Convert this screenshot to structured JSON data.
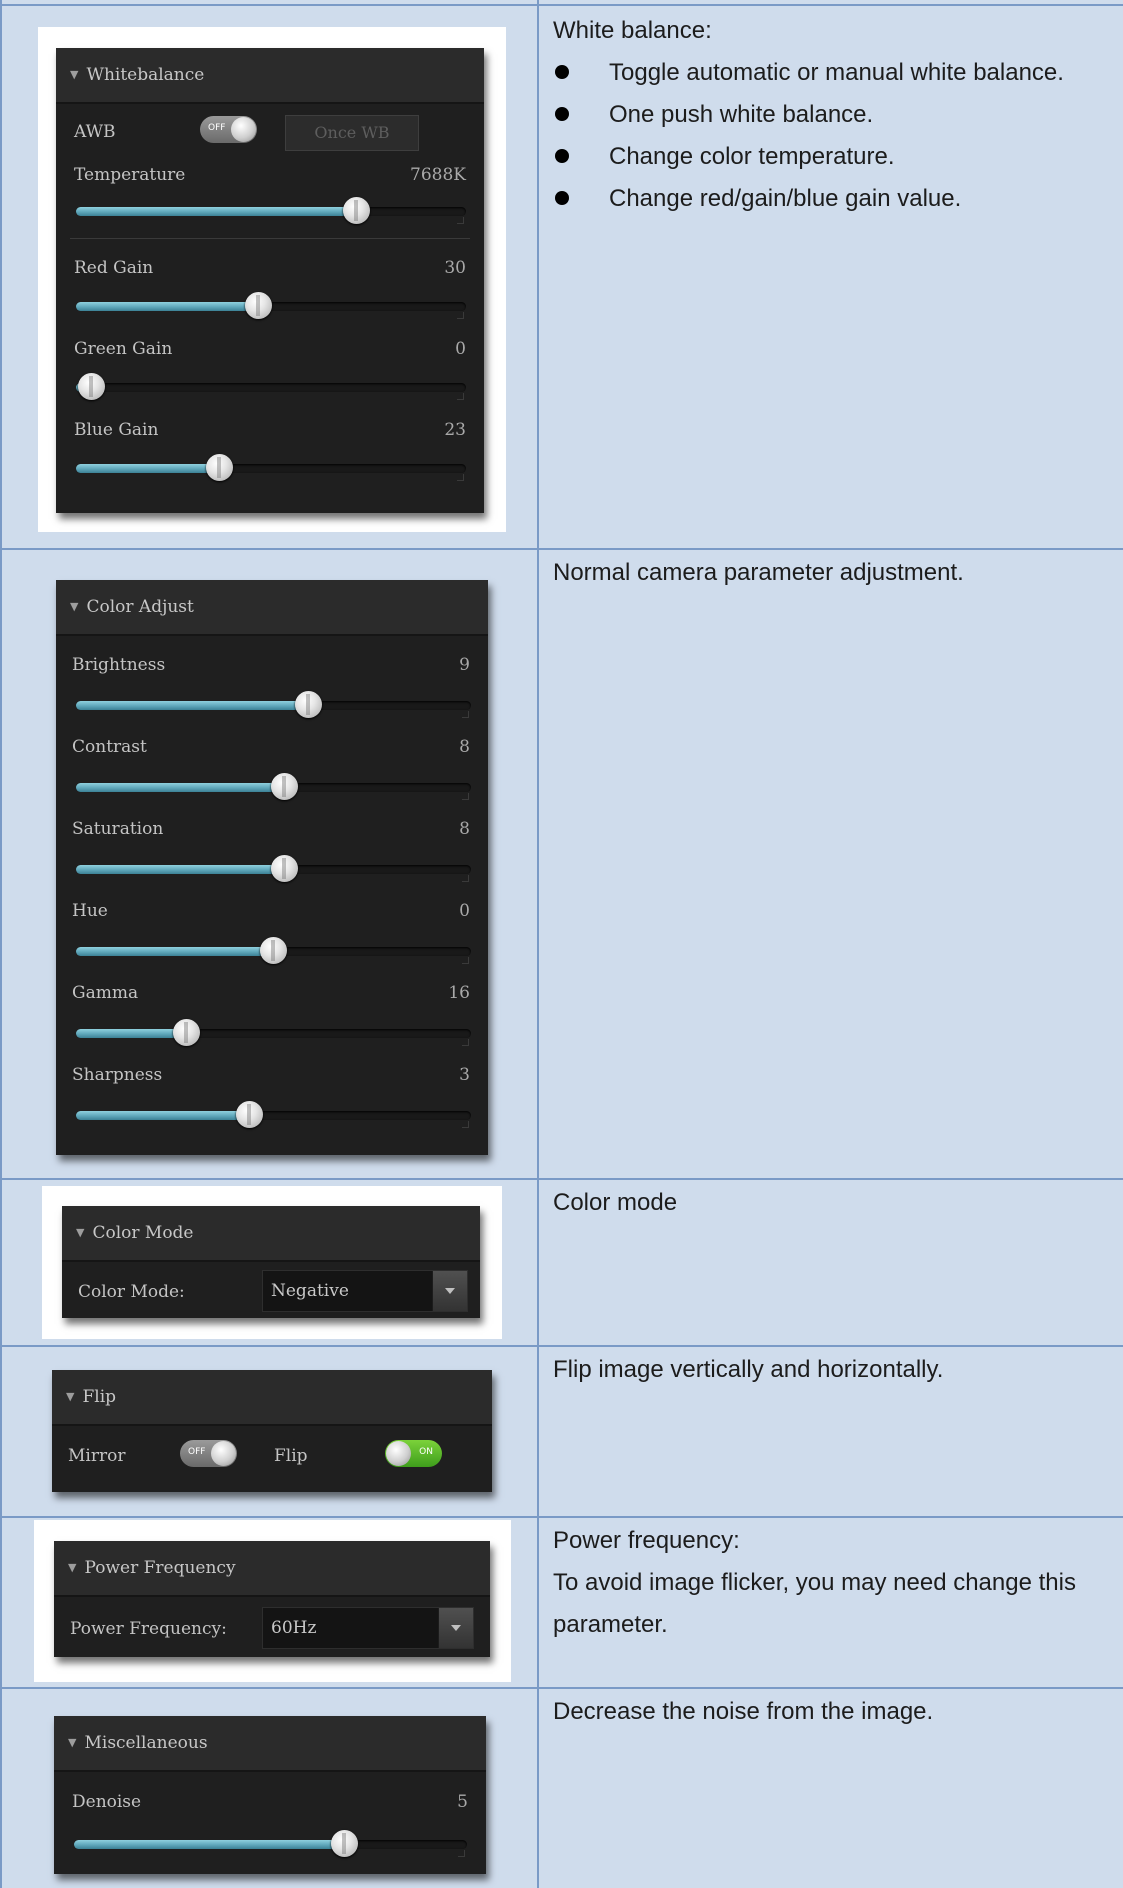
{
  "rows": [
    {
      "description_title": "White balance:",
      "bullets": [
        "Toggle automatic or manual white balance.",
        "One push white balance.",
        "Change color temperature.",
        "Change red/gain/blue gain value."
      ],
      "panel": {
        "title": "Whitebalance",
        "awb_label": "AWB",
        "awb_toggle": {
          "state": "OFF",
          "on": false
        },
        "once_wb_label": "Once WB",
        "sliders": [
          {
            "label": "Temperature",
            "value": "7688K",
            "fill": 0.72
          },
          {
            "label": "Red Gain",
            "value": "30",
            "fill": 0.47
          },
          {
            "label": "Green Gain",
            "value": "0",
            "fill": 0.04
          },
          {
            "label": "Blue Gain",
            "value": "23",
            "fill": 0.37
          }
        ]
      }
    },
    {
      "description": "Normal camera parameter adjustment.",
      "panel": {
        "title": "Color Adjust",
        "sliders": [
          {
            "label": "Brightness",
            "value": "9",
            "fill": 0.59
          },
          {
            "label": "Contrast",
            "value": "8",
            "fill": 0.53
          },
          {
            "label": "Saturation",
            "value": "8",
            "fill": 0.53
          },
          {
            "label": "Hue",
            "value": "0",
            "fill": 0.5
          },
          {
            "label": "Gamma",
            "value": "16",
            "fill": 0.28
          },
          {
            "label": "Sharpness",
            "value": "3",
            "fill": 0.44
          }
        ]
      }
    },
    {
      "description": "Color mode",
      "panel": {
        "title": "Color Mode",
        "field_label": "Color Mode:",
        "selected": "Negative"
      }
    },
    {
      "description": "Flip image vertically and horizontally.",
      "panel": {
        "title": "Flip",
        "mirror_label": "Mirror",
        "mirror_toggle": {
          "state": "OFF",
          "on": false
        },
        "flip_label": "Flip",
        "flip_toggle": {
          "state": "ON",
          "on": true
        }
      }
    },
    {
      "description_lines": [
        "Power frequency:",
        "To avoid image flicker, you may need change this",
        "parameter."
      ],
      "panel": {
        "title": "Power Frequency",
        "field_label": "Power Frequency:",
        "selected": "60Hz"
      }
    },
    {
      "description": "Decrease the noise from the image.",
      "panel": {
        "title": "Miscellaneous",
        "sliders": [
          {
            "label": "Denoise",
            "value": "5",
            "fill": 0.69
          }
        ]
      }
    }
  ],
  "colors": {
    "cell_background": "#cfdcec",
    "border": "#7a9ac6",
    "panel_background": "#1f1f1f",
    "slider_fill": "#5fa7ba",
    "toggle_on": "#4aa822",
    "toggle_off": "#7a7a7a"
  },
  "icons": {
    "bullet": "filled-circle",
    "collapse": "triangle-down",
    "dropdown": "chevron-down"
  }
}
